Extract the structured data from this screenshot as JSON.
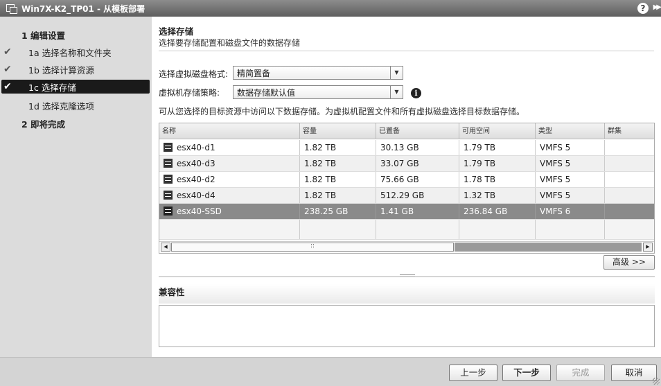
{
  "window": {
    "title": "Win7X-K2_TP01 - 从模板部署",
    "help_label": "?"
  },
  "nav": {
    "items": [
      {
        "label": "1 编辑设置",
        "checked": false,
        "active": false,
        "bold": true
      },
      {
        "label": "1a 选择名称和文件夹",
        "checked": true,
        "active": false,
        "bold": false
      },
      {
        "label": "1b 选择计算资源",
        "checked": true,
        "active": false,
        "bold": false
      },
      {
        "label": "1c 选择存储",
        "checked": true,
        "active": true,
        "bold": false
      },
      {
        "label": "1d 选择克隆选项",
        "checked": false,
        "active": false,
        "bold": false
      },
      {
        "label": "2 即将完成",
        "checked": false,
        "active": false,
        "bold": true
      }
    ]
  },
  "header": {
    "title": "选择存储",
    "subtitle": "选择要存储配置和磁盘文件的数据存储"
  },
  "form": {
    "disk_format_label": "选择虚拟磁盘格式:",
    "disk_format_value": "精简置备",
    "storage_policy_label": "虚拟机存储策略:",
    "storage_policy_value": "数据存储默认值",
    "description": "可从您选择的目标资源中访问以下数据存储。为虚拟机配置文件和所有虚拟磁盘选择目标数据存储。"
  },
  "table": {
    "columns": [
      "名称",
      "容量",
      "已置备",
      "可用空间",
      "类型",
      "群集"
    ],
    "rows": [
      {
        "name": "esx40-d1",
        "capacity": "1.82 TB",
        "provisioned": "30.13 GB",
        "free": "1.79 TB",
        "type": "VMFS 5",
        "cluster": ""
      },
      {
        "name": "esx40-d3",
        "capacity": "1.82 TB",
        "provisioned": "33.07 GB",
        "free": "1.79 TB",
        "type": "VMFS 5",
        "cluster": ""
      },
      {
        "name": "esx40-d2",
        "capacity": "1.82 TB",
        "provisioned": "75.66 GB",
        "free": "1.78 TB",
        "type": "VMFS 5",
        "cluster": ""
      },
      {
        "name": "esx40-d4",
        "capacity": "1.82 TB",
        "provisioned": "512.29 GB",
        "free": "1.32 TB",
        "type": "VMFS 5",
        "cluster": ""
      },
      {
        "name": "esx40-SSD",
        "capacity": "238.25 GB",
        "provisioned": "1.41 GB",
        "free": "236.84 GB",
        "type": "VMFS 6",
        "cluster": ""
      }
    ],
    "selected_row": 4,
    "scroll_grip": "::"
  },
  "advanced_button": "高级 >>",
  "compat": {
    "title": "兼容性"
  },
  "footer": {
    "back": "上一步",
    "next": "下一步",
    "finish": "完成",
    "cancel": "取消"
  },
  "icons": {
    "check": "check-icon",
    "datastore": "datastore-icon",
    "info": "info-icon"
  }
}
